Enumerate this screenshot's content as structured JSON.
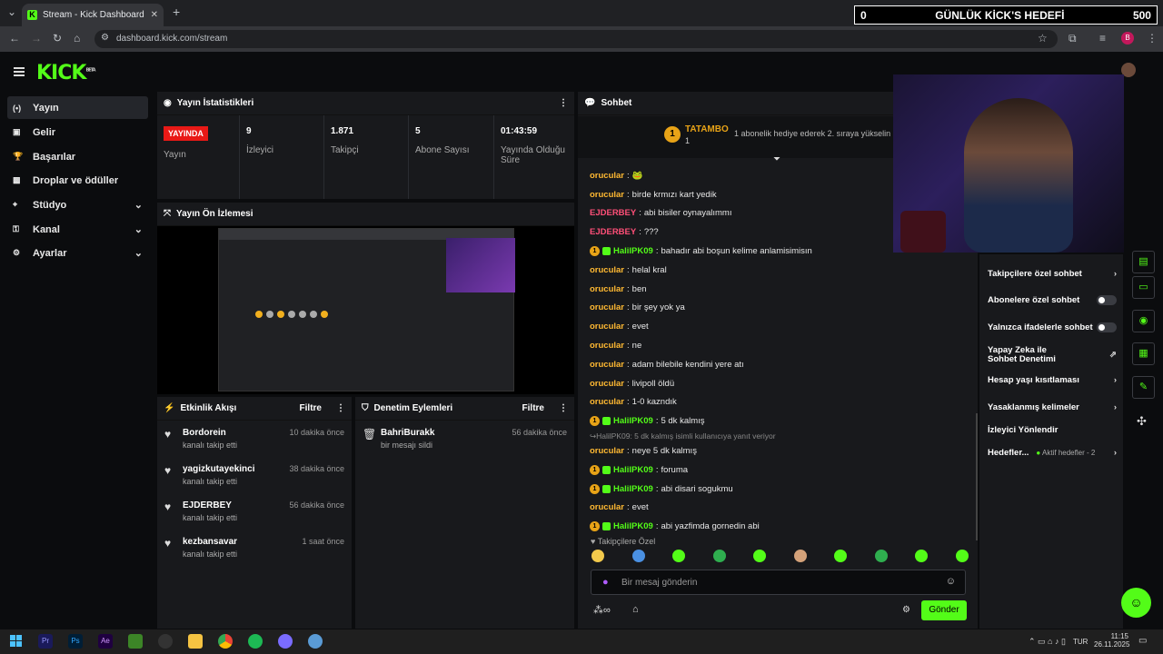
{
  "browser": {
    "tab_title": "Stream - Kick Dashboard",
    "url": "dashboard.kick.com/stream"
  },
  "goal": {
    "current": "0",
    "title": "GÜNLÜK KİCK'S HEDEFİ",
    "target": "500"
  },
  "logo": "KICK",
  "logo_beta": "BETA",
  "sidebar": {
    "items": [
      {
        "label": "Yayın",
        "icon": "broadcast-icon"
      },
      {
        "label": "Gelir",
        "icon": "revenue-icon"
      },
      {
        "label": "Başarılar",
        "icon": "trophy-icon"
      },
      {
        "label": "Droplar ve ödüller",
        "icon": "gift-icon"
      },
      {
        "label": "Stüdyo",
        "icon": "studio-icon"
      },
      {
        "label": "Kanal",
        "icon": "channel-icon"
      },
      {
        "label": "Ayarlar",
        "icon": "settings-icon"
      }
    ]
  },
  "stats": {
    "title": "Yayın İstatistikleri",
    "status_badge": "YAYINDA",
    "status_label": "Yayın",
    "viewers": "9",
    "viewers_label": "İzleyici",
    "followers": "1.871",
    "followers_label": "Takipçi",
    "subs": "5",
    "subs_label": "Abone Sayısı",
    "uptime": "01:43:59",
    "uptime_label": "Yayında Olduğu Süre"
  },
  "preview": {
    "title": "Yayın Ön İzlemesi"
  },
  "activity": {
    "title": "Etkinlik Akışı",
    "filter": "Filtre",
    "events": [
      {
        "name": "Bordorein",
        "sub": "kanalı takip etti",
        "time": "10 dakika önce"
      },
      {
        "name": "yagizkutayekinci",
        "sub": "kanalı takip etti",
        "time": "38 dakika önce"
      },
      {
        "name": "EJDERBEY",
        "sub": "kanalı takip etti",
        "time": "56 dakika önce"
      },
      {
        "name": "kezbansavar",
        "sub": "kanalı takip etti",
        "time": "1 saat önce"
      }
    ]
  },
  "moderation": {
    "title": "Denetim Eylemleri",
    "filter": "Filtre",
    "events": [
      {
        "name": "BahriBurakk",
        "sub": "bir mesajı sildi",
        "time": "56 dakika önce"
      }
    ]
  },
  "chat": {
    "title": "Sohbet",
    "pinned_user": "TATAMBO",
    "pinned_count": "1",
    "pinned_text": "1 abonelik hediye ederek 2. sıraya yükselin",
    "messages": [
      {
        "user": "orucular",
        "color": "o",
        "text": "🐸",
        "badges": false
      },
      {
        "user": "orucular",
        "color": "o",
        "text": "birde krmızı kart yedik",
        "badges": false
      },
      {
        "user": "EJDERBEY",
        "color": "r",
        "text": "abi bisiler oynayalımmı",
        "badges": false
      },
      {
        "user": "EJDERBEY",
        "color": "r",
        "text": "???",
        "badges": false
      },
      {
        "user": "HalilPK09",
        "color": "g",
        "text": "bahadır abi boşun kelime anlamisimisın",
        "badges": true
      },
      {
        "user": "orucular",
        "color": "o",
        "text": "helal kral",
        "badges": false
      },
      {
        "user": "orucular",
        "color": "o",
        "text": "ben",
        "badges": false
      },
      {
        "user": "orucular",
        "color": "o",
        "text": "bir şey yok ya",
        "badges": false
      },
      {
        "user": "orucular",
        "color": "o",
        "text": "evet",
        "badges": false
      },
      {
        "user": "orucular",
        "color": "o",
        "text": "ne",
        "badges": false
      },
      {
        "user": "orucular",
        "color": "o",
        "text": "adam bilebile kendini yere atı",
        "badges": false
      },
      {
        "user": "orucular",
        "color": "o",
        "text": "livipoll öldü",
        "badges": false
      },
      {
        "user": "orucular",
        "color": "o",
        "text": "1-0 kazndık",
        "badges": false
      },
      {
        "user": "HalilPK09",
        "color": "g",
        "text": "5 dk kalmış",
        "badges": true
      }
    ],
    "reply_hint": "HalilPK09: 5 dk kalmış isimli kullanıcıya yanıt veriyor",
    "messages2": [
      {
        "user": "orucular",
        "color": "o",
        "text": "neye 5 dk kalmış",
        "badges": false
      },
      {
        "user": "HalilPK09",
        "color": "g",
        "text": "foruma",
        "badges": true
      },
      {
        "user": "HalilPK09",
        "color": "g",
        "text": "abi disari sogukmu",
        "badges": true
      },
      {
        "user": "orucular",
        "color": "o",
        "text": "evet",
        "badges": false
      },
      {
        "user": "HalilPK09",
        "color": "g",
        "text": "abi yazfimda gornedin abi",
        "badges": true
      }
    ],
    "mode_label": "Takipçilere Özel",
    "input_placeholder": "Bir mesaj gönderin",
    "send_label": "Gönder"
  },
  "chat_settings": {
    "rows": [
      {
        "label": "Takipçilere özel sohbet",
        "end": "chevron"
      },
      {
        "label": "Abonelere özel sohbet",
        "end": "toggle"
      },
      {
        "label": "Yalnızca ifadelerle sohbet",
        "end": "toggle"
      },
      {
        "label": "Yapay Zeka ile Sohbet Denetimi",
        "end": "external"
      },
      {
        "label": "Hesap yaşı kısıtlaması",
        "end": "chevron"
      },
      {
        "label": "Yasaklanmış kelimeler",
        "end": "chevron"
      },
      {
        "label": "İzleyici Yönlendir",
        "end": "none"
      },
      {
        "label": "Hedefler...",
        "end": "chevron",
        "extra": "Aktif hedefler - 2"
      }
    ]
  },
  "taskbar": {
    "lang": "TUR",
    "time": "11:15",
    "date": "26.11.2025"
  },
  "colors": {
    "accent": "#53fc18",
    "live": "#e91916",
    "panel": "#18191c",
    "bg": "#0b0c0e"
  }
}
